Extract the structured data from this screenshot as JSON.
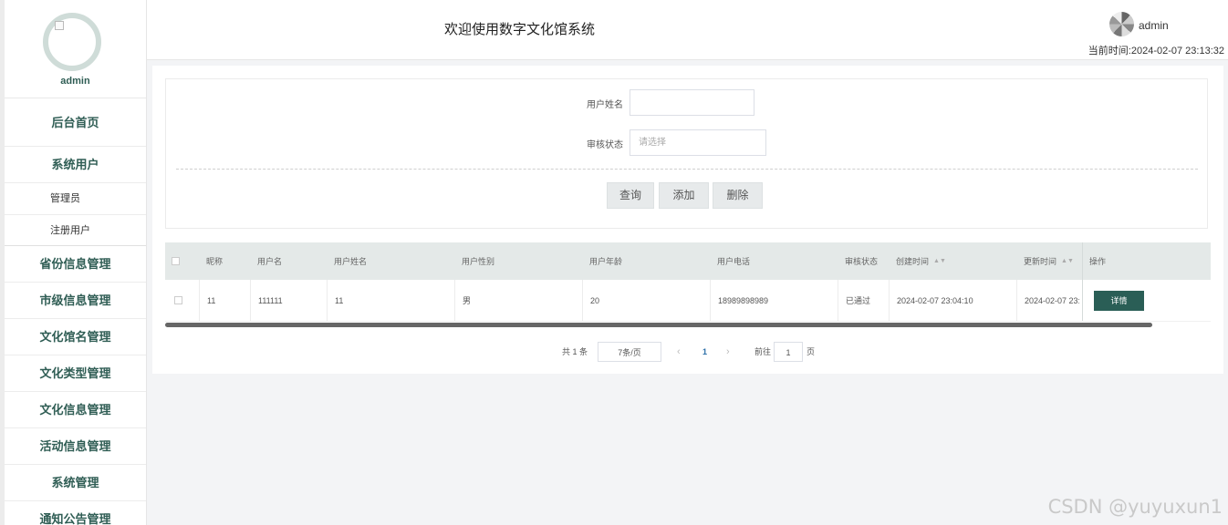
{
  "sidebar": {
    "profile_name": "admin",
    "home": "后台首页",
    "group_label": "系统用户",
    "sub_items": [
      "管理员",
      "注册用户"
    ],
    "items": [
      "省份信息管理",
      "市级信息管理",
      "文化馆名管理",
      "文化类型管理",
      "文化信息管理",
      "活动信息管理",
      "系统管理",
      "通知公告管理"
    ]
  },
  "header": {
    "title": "欢迎使用数字文化馆系统",
    "user": "admin",
    "time_label": "当前时间:",
    "time_value": "2024-02-07 23:13:32"
  },
  "search": {
    "name_label": "用户姓名",
    "name_value": "",
    "status_label": "审核状态",
    "status_placeholder": "请选择",
    "buttons": {
      "query": "查询",
      "add": "添加",
      "delete": "删除"
    }
  },
  "table": {
    "columns": [
      "昵称",
      "用户名",
      "用户姓名",
      "用户性别",
      "用户年龄",
      "用户电话",
      "审核状态",
      "创建时间",
      "更新时间",
      "操作"
    ],
    "rows": [
      {
        "nickname": "11",
        "username": "111111",
        "realname": "11",
        "gender": "男",
        "age": "20",
        "phone": "18989898989",
        "status": "已通过",
        "created": "2024-02-07 23:04:10",
        "updated": "2024-02-07 23:",
        "action": "详情"
      }
    ]
  },
  "pager": {
    "total": "共 1 条",
    "page_size": "7条/页",
    "prev": "‹",
    "current": "1",
    "next": "›",
    "goto_label": "前往",
    "goto_value": "1",
    "goto_unit": "页"
  },
  "watermark": "CSDN @yuyuxun1",
  "colors": {
    "accent": "#2a5e56",
    "menu_text": "#2f5d54"
  }
}
